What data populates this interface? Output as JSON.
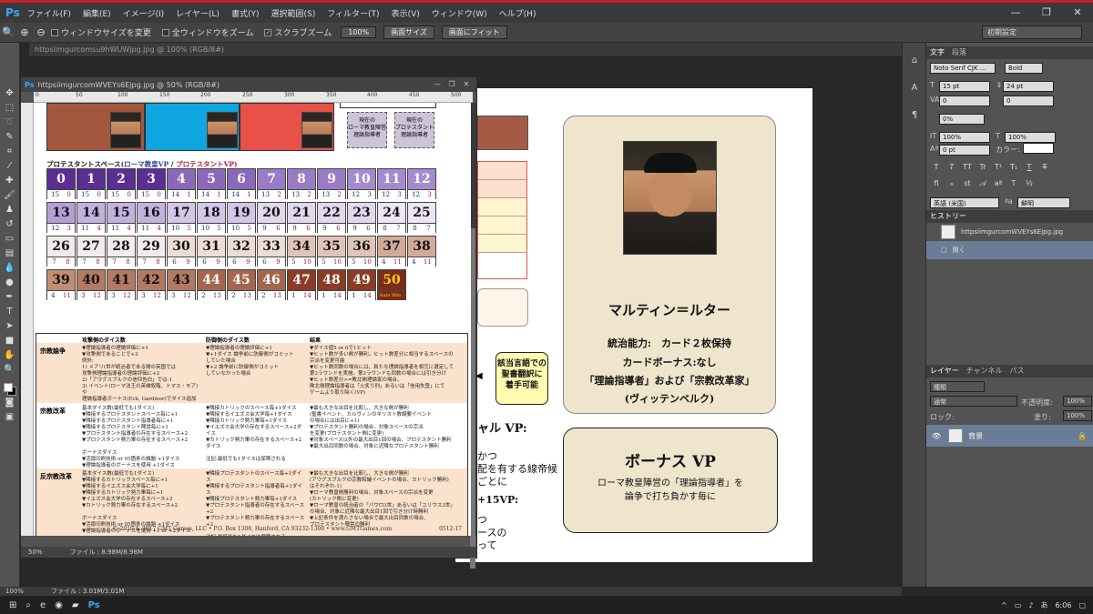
{
  "app": {
    "logo": "Ps",
    "menus": [
      "ファイル(F)",
      "編集(E)",
      "イメージ(I)",
      "レイヤー(L)",
      "書式(Y)",
      "選択範囲(S)",
      "フィルター(T)",
      "表示(V)",
      "ウィンドウ(W)",
      "ヘルプ(H)"
    ],
    "window_controls": [
      "—",
      "❐",
      "✕"
    ]
  },
  "options": {
    "fit_window": "ウィンドウサイズを変更",
    "all_windows": "全ウィンドウをズーム",
    "scrubby": "スクラブズーム",
    "btn_100": "100%",
    "btn_screen": "画面サイズ",
    "btn_fit": "画面にフィット",
    "workspace": "初期設定"
  },
  "tabs": {
    "main_doc": "httpsiimgurcomsu9hWUWjpg.jpg @ 100% (RGB/8#)",
    "float_doc": "httpsiimgurcomWVEYs6Ejpg.jpg @ 50% (RGB/8#)"
  },
  "float_window": {
    "ruler": [
      "0",
      "50",
      "100",
      "150",
      "200",
      "250",
      "300",
      "350",
      "400",
      "450",
      "500"
    ],
    "zoom": "50%",
    "file_info": "ファイル : 8.98M/8.98M"
  },
  "sheet": {
    "markers": [
      {
        "label": "現在の\nローマ教皇陣営\n理論指導者"
      },
      {
        "label": "現在の\nプロテスタント\n理論指導者"
      }
    ],
    "space_title_main": "プロテスタントスペース",
    "space_title_vp_rome": "(ローマ教皇VP",
    "space_title_sep": " / ",
    "space_title_vp_prot": "プロテスタントVP)",
    "cells": [
      {
        "n": "0",
        "a": "15",
        "b": "0"
      },
      {
        "n": "1",
        "a": "15",
        "b": "0"
      },
      {
        "n": "2",
        "a": "15",
        "b": "0"
      },
      {
        "n": "3",
        "a": "15",
        "b": "0"
      },
      {
        "n": "4",
        "a": "14",
        "b": "1"
      },
      {
        "n": "5",
        "a": "14",
        "b": "1"
      },
      {
        "n": "6",
        "a": "14",
        "b": "1"
      },
      {
        "n": "7",
        "a": "13",
        "b": "2"
      },
      {
        "n": "8",
        "a": "13",
        "b": "2"
      },
      {
        "n": "9",
        "a": "13",
        "b": "2"
      },
      {
        "n": "10",
        "a": "12",
        "b": "3"
      },
      {
        "n": "11",
        "a": "12",
        "b": "3"
      },
      {
        "n": "12",
        "a": "12",
        "b": "3"
      },
      {
        "n": "13",
        "a": "12",
        "b": "3"
      },
      {
        "n": "14",
        "a": "11",
        "b": "4"
      },
      {
        "n": "15",
        "a": "11",
        "b": "4"
      },
      {
        "n": "16",
        "a": "11",
        "b": "4"
      },
      {
        "n": "17",
        "a": "10",
        "b": "5"
      },
      {
        "n": "18",
        "a": "10",
        "b": "5"
      },
      {
        "n": "19",
        "a": "10",
        "b": "5"
      },
      {
        "n": "20",
        "a": "9",
        "b": "6"
      },
      {
        "n": "21",
        "a": "9",
        "b": "6"
      },
      {
        "n": "22",
        "a": "9",
        "b": "6"
      },
      {
        "n": "23",
        "a": "9",
        "b": "6"
      },
      {
        "n": "24",
        "a": "8",
        "b": "7"
      },
      {
        "n": "25",
        "a": "8",
        "b": "7"
      },
      {
        "n": "26",
        "a": "7",
        "b": "8"
      },
      {
        "n": "27",
        "a": "7",
        "b": "8"
      },
      {
        "n": "28",
        "a": "7",
        "b": "8"
      },
      {
        "n": "29",
        "a": "7",
        "b": "8"
      },
      {
        "n": "30",
        "a": "6",
        "b": "9"
      },
      {
        "n": "31",
        "a": "6",
        "b": "9"
      },
      {
        "n": "32",
        "a": "6",
        "b": "9"
      },
      {
        "n": "33",
        "a": "6",
        "b": "9"
      },
      {
        "n": "34",
        "a": "5",
        "b": "10"
      },
      {
        "n": "35",
        "a": "5",
        "b": "10"
      },
      {
        "n": "36",
        "a": "5",
        "b": "10"
      },
      {
        "n": "37",
        "a": "4",
        "b": "11"
      },
      {
        "n": "38",
        "a": "4",
        "b": "11"
      },
      {
        "n": "39",
        "a": "4",
        "b": "11"
      },
      {
        "n": "40",
        "a": "3",
        "b": "12"
      },
      {
        "n": "41",
        "a": "3",
        "b": "12"
      },
      {
        "n": "42",
        "a": "3",
        "b": "12"
      },
      {
        "n": "43",
        "a": "3",
        "b": "12"
      },
      {
        "n": "44",
        "a": "2",
        "b": "13"
      },
      {
        "n": "45",
        "a": "2",
        "b": "13"
      },
      {
        "n": "46",
        "a": "2",
        "b": "13"
      },
      {
        "n": "47",
        "a": "1",
        "b": "14"
      },
      {
        "n": "48",
        "a": "1",
        "b": "14"
      },
      {
        "n": "49",
        "a": "1",
        "b": "14"
      },
      {
        "n": "50",
        "a": "Auto Win",
        "b": ""
      }
    ],
    "rules_headers": [
      "攻撃側のダイス数",
      "防御側のダイス数",
      "結果"
    ],
    "rules_rows": [
      {
        "title": "宗教論争",
        "c1": "▼理論指導者の理論評価に+1\n▼攻撃側であることで+3\n例外:\n1) メアリ(世が統治者である間の英国では\n攻撃側理論指導者の理論評価に+2\n2)「アウグスブルクの信仰告白」では-1\n3) イベント(ローマ法王の英雄叙階、トマス・モア)や\n理論指導者ボーナス(Eck, Gardiner)でダイス追加",
        "c2": "▼理論指導者の理論評価に+1\n▼+1ダイス 論争前に防御側がコミット\nしていた場合\n▼+2 論争前に防御側がコミット\nしていなかった場合",
        "c3": "▼ダイス値5 or 6で1ヒット\n▼ヒット数が多い側が勝利。ヒット数差分に相当するスペースの\n宗派を変更可能\n▼ヒット数同数の場合には、新たな理論指導者を相互に選定して\n第2ラウンドを実施。第2ラウンドも同数の場合には引き分け\n▼ヒット数差分>=敗北側理論家の場合、\n敗北側理論指導者は「火炙り刑」あるいは「信用失墜」にて\nゲームより取り除く(VP)"
      },
      {
        "title": "宗教改革",
        "c1": "基本ダイス数(最低でも1ダイス)\n▼隣接するプロテスタントスペース毎に+1\n▼隣接するプロテスタント指導者毎に+1\n▼隣接するプロテスタント陣営毎に+1\n▼プロテスタント指導者の存在するスペース+2\n▼プロテスタント勢力軍の存在するスペース+2\n\nボーナスダイス\n▼活版印刷技術 or 95箇条の論題 +1ダイス\n▼理論指導者のボーナスを使用 +1ダイス",
        "c2": "▼隣接カトリックのスペース毎+1ダイス\n▼隣接するイエズス会大学毎+1ダイス\n▼隣接カトリック勢力軍毎+1ダイス\n▼イエズス会大学の存在するスペース+2ダイス\n▼カトリック勢力軍の存在するスペース+2ダイス\n\n注記:最低でも1ダイスは保障される",
        "c3": "▼最も大きな出目を比較し、大きな側が勝利\n(聖書イベント、カルヴィンのキリスト教綱要イベント\nの場合には出目に+1)\n▼プロテスタント勝利の場合、対象スペースの宗派\nを変更(プロテスタント側に変更)\n▼対象スペース以外の最大出目1回の場合、プロテスタント勝利\n▼最大出目同数の場合、対象に近隣なプロテスタント勝利"
      },
      {
        "title": "反宗教改革",
        "c1": "基本ダイス数(最低でも1ダイス)\n▼隣接するカトリックスペース毎に+1\n▼隣接するイエズス会大学毎に+1\n▼隣接するカトリック勢力軍毎に+1\n▼イエズス会大学の存在するスペース+2\n▼カトリック勢力軍の存在するスペース+2\n\nボーナスダイス\n▼活版印刷技術 or 95箇条の論題 +1ダイス\n▼理論指導者のボーナスを使用 +1 or +2ダイス",
        "c2": "▼隣接プロテスタントのスペース毎+1ダイス\n▼隣接するプロテスタント指導者毎+1ダイス\n▼隣接プロテスタント勢力軍毎+1ダイス\n▼プロテスタント指導者の存在するスペース+2\n▼プロテスタント勢力軍の存在するスペース+2\n\n注記:最低でも1ダイスは保障される",
        "c3": "▼最も大きな出目を比較し、大きな側が勝利\n(アウグスブルクの宗教和議イベントの場合、カトリック勝利)\nはそれぞれ-1)\n▼ローマ教皇側勝利の場合、対象スペースの宗派を変更\n(カトリック側に変更)\n▼ローマ教皇の統治者の「パウロ3世」あるいは「ユリウス3世」\nの場合、対象に近隣な最大出目1回で引き分け時勝利\n▼上記条件を満たさない場合で最大出目同数の場合、\nプロテスタント陣営の勝利"
      }
    ],
    "footer": "© 2010 & 2017 GMT Games, LLC • P.O. Box 1308, Hanford, CA 93232-1308 • www.GMTGames.com",
    "code": "0512-17"
  },
  "doc2": {
    "yellow_note": "該当言語での\n聖書翻訳に\n着手可能",
    "frag1": "ャル VP:",
    "frag2": "かつ\n配を有する線帝候\nごとに",
    "frag3": "+15VP:",
    "frag4": "つ\nースの\nって",
    "card": {
      "name": "マルティン＝ルター",
      "l1": "統治能力:　カード２枚保持",
      "l2": "カードボーナス:なし",
      "l3": "「理論指導者」および「宗教改革家」",
      "l4": "(ヴィッテンベルク)"
    },
    "bonus": {
      "title": "ボーナス VP",
      "l1": "ローマ教皇陣営の「理論指導者」を",
      "l2": "論争で打ち負かす毎に"
    }
  },
  "panel": {
    "tabs_char": [
      "文字",
      "段落"
    ],
    "font": "Noto Serif CJK ...",
    "style": "Bold",
    "size": "15 pt",
    "leading": "24 pt",
    "kerning": "0",
    "tracking": "0%",
    "vscale": "100%",
    "hscale": "100%",
    "baseline": "0 pt",
    "color_label": "カラー:",
    "lang": "英語 (米国)",
    "aa": "鮮明",
    "tabs_hist": [
      "ヒストリー"
    ],
    "hist_doc": "httpsiimgurcomWVEYs6Ejpg.jpg",
    "hist_open": "開く",
    "tabs_layers": [
      "レイヤー",
      "チャンネル",
      "パス"
    ],
    "kind": "種類",
    "blend": "通常",
    "opacity_label": "不透明度:",
    "opacity": "100%",
    "lock_label": "ロック:",
    "fill_label": "塗り:",
    "fill": "100%",
    "layer_name": "背景"
  },
  "status": {
    "zoom": "100%",
    "file": "ファイル : 3.01M/3.01M"
  },
  "taskbar": {
    "ime": "あ",
    "time": "6:06"
  }
}
